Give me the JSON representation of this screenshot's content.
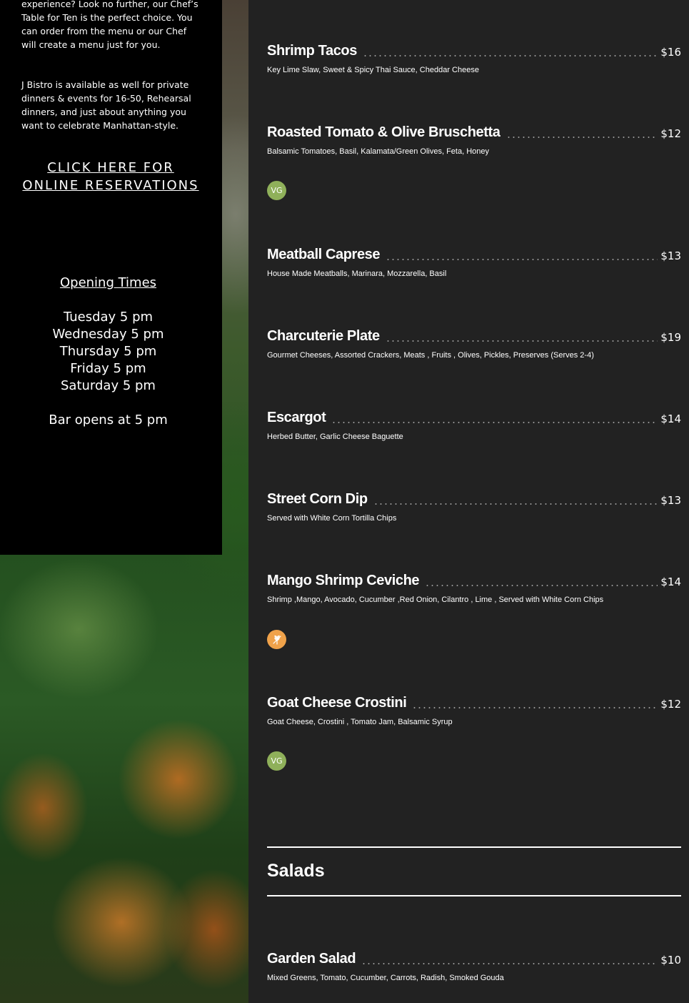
{
  "info": {
    "paragraph1": "experience? Look no further, our Chef’s Table for Ten is the perfect choice. You can order from the menu or our Chef will create a menu just for you.",
    "paragraph2": "J Bistro is available as well for private dinners & events for 16-50, Rehearsal dinners, and just about anything you want to celebrate Manhattan-style.",
    "reservation_link": "CLICK HERE FOR ONLINE RESERVATIONS"
  },
  "hours": {
    "title": "Opening Times",
    "days": [
      "Tuesday 5 pm",
      "Wednesday 5 pm",
      "Thursday 5 pm",
      "Friday 5 pm",
      "Saturday 5 pm"
    ],
    "bar": "Bar opens at 5 pm"
  },
  "menu": {
    "items": [
      {
        "name": "Shrimp Tacos",
        "price": "$16",
        "description": "Key Lime Slaw, Sweet & Spicy Thai Sauce, Cheddar Cheese"
      },
      {
        "name": "Roasted Tomato & Olive Bruschetta",
        "price": "$12",
        "description": "Balsamic Tomatoes, Basil, Kalamata/Green Olives, Feta, Honey",
        "badge": "VG"
      },
      {
        "name": "Meatball Caprese",
        "price": "$13",
        "description": "House Made Meatballs, Marinara, Mozzarella, Basil"
      },
      {
        "name": "Charcuterie Plate",
        "price": "$19",
        "description": "Gourmet Cheeses, Assorted Crackers, Meats , Fruits , Olives, Pickles, Preserves (Serves 2-4)"
      },
      {
        "name": "Escargot",
        "price": "$14",
        "description": "Herbed Butter, Garlic Cheese Baguette"
      },
      {
        "name": "Street Corn Dip",
        "price": "$13",
        "description": "Served with White Corn Tortilla Chips"
      },
      {
        "name": "Mango Shrimp Ceviche",
        "price": "$14",
        "description": "Shrimp ,Mango, Avocado, Cucumber ,Red Onion, Cilantro , Lime , Served with White Corn Chips",
        "icon": "gluten-free-icon"
      },
      {
        "name": "Goat Cheese Crostini",
        "price": "$12",
        "description": "Goat Cheese, Crostini , Tomato Jam, Balsamic Syrup",
        "badge": "VG"
      }
    ],
    "salads_title": "Salads",
    "salads": [
      {
        "name": "Garden Salad",
        "price": "$10",
        "description": "Mixed Greens, Tomato, Cucumber, Carrots, Radish, Smoked Gouda"
      }
    ]
  },
  "colors": {
    "menu_bg": "#222222",
    "panel_bg": "#000000",
    "vegetarian_badge": "#8fb05a",
    "gluten_free_badge": "#f0a24a"
  }
}
